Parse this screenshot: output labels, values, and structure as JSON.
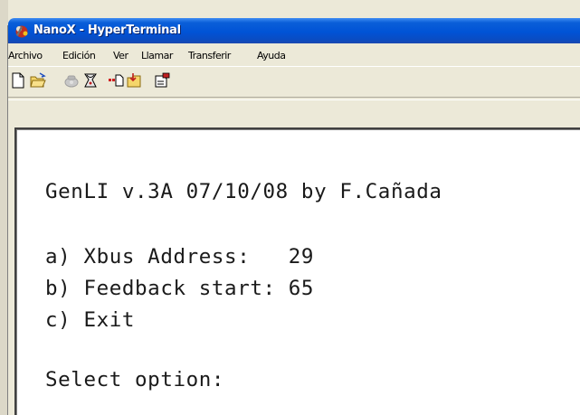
{
  "window": {
    "title": "NanoX - HyperTerminal"
  },
  "menu": [
    "Archivo",
    "Edición",
    "Ver",
    "Llamar",
    "Transferir",
    "Ayuda"
  ],
  "toolbar": {
    "buttons": [
      "new-icon",
      "open-icon",
      "call-icon",
      "disconnect-icon",
      "send-icon",
      "receive-icon",
      "properties-icon"
    ]
  },
  "terminal": {
    "lines": [
      "GenLI v.3A 07/10/08 by F.Cañada",
      "a) Xbus Address:   29",
      "b) Feedback start: 65",
      "c) Exit",
      "Select option:"
    ]
  }
}
